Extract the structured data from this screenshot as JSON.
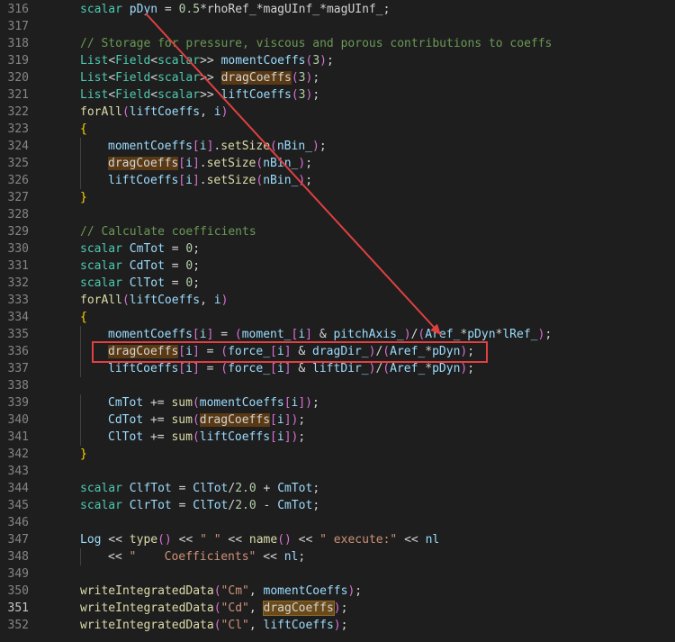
{
  "editor": {
    "active_line": "351",
    "lines": [
      {
        "n": "316",
        "indent": 1,
        "tokens": [
          [
            "ty",
            "scalar"
          ],
          [
            "op",
            " "
          ],
          [
            "va",
            "pDyn"
          ],
          [
            "op",
            " = "
          ],
          [
            "nu",
            "0.5"
          ],
          [
            "op",
            "*rhoRef_*magUInf_*magUInf_;"
          ]
        ]
      },
      {
        "n": "317",
        "indent": 0,
        "tokens": []
      },
      {
        "n": "318",
        "indent": 1,
        "tokens": [
          [
            "cm",
            "// Storage for pressure, viscous and porous contributions to coeffs"
          ]
        ]
      },
      {
        "n": "319",
        "indent": 1,
        "tokens": [
          [
            "ty",
            "List"
          ],
          [
            "op",
            "<"
          ],
          [
            "ty",
            "Field"
          ],
          [
            "op",
            "<"
          ],
          [
            "ty",
            "scalar"
          ],
          [
            "op",
            ">> "
          ],
          [
            "va",
            "momentCoeffs"
          ],
          [
            "br",
            "("
          ],
          [
            "nu",
            "3"
          ],
          [
            "br",
            ")"
          ],
          [
            "op",
            ";"
          ]
        ]
      },
      {
        "n": "320",
        "indent": 1,
        "tokens": [
          [
            "ty",
            "List"
          ],
          [
            "op",
            "<"
          ],
          [
            "ty",
            "Field"
          ],
          [
            "op",
            "<"
          ],
          [
            "ty",
            "scalar"
          ],
          [
            "op",
            ">> "
          ],
          [
            "hl",
            "dragCoeffs"
          ],
          [
            "br",
            "("
          ],
          [
            "nu",
            "3"
          ],
          [
            "br",
            ")"
          ],
          [
            "op",
            ";"
          ]
        ]
      },
      {
        "n": "321",
        "indent": 1,
        "tokens": [
          [
            "ty",
            "List"
          ],
          [
            "op",
            "<"
          ],
          [
            "ty",
            "Field"
          ],
          [
            "op",
            "<"
          ],
          [
            "ty",
            "scalar"
          ],
          [
            "op",
            ">> "
          ],
          [
            "va",
            "liftCoeffs"
          ],
          [
            "br",
            "("
          ],
          [
            "nu",
            "3"
          ],
          [
            "br",
            ")"
          ],
          [
            "op",
            ";"
          ]
        ]
      },
      {
        "n": "322",
        "indent": 1,
        "tokens": [
          [
            "kw",
            "forAll"
          ],
          [
            "br",
            "("
          ],
          [
            "va",
            "liftCoeffs"
          ],
          [
            "op",
            ", "
          ],
          [
            "va",
            "i"
          ],
          [
            "br",
            ")"
          ]
        ]
      },
      {
        "n": "323",
        "indent": 1,
        "tokens": [
          [
            "pu",
            "{"
          ]
        ]
      },
      {
        "n": "324",
        "indent": 2,
        "tokens": [
          [
            "va",
            "momentCoeffs"
          ],
          [
            "br",
            "["
          ],
          [
            "va",
            "i"
          ],
          [
            "br",
            "]"
          ],
          [
            "op",
            "."
          ],
          [
            "kw",
            "setSize"
          ],
          [
            "br",
            "("
          ],
          [
            "va",
            "nBin_"
          ],
          [
            "br",
            ")"
          ],
          [
            "op",
            ";"
          ]
        ]
      },
      {
        "n": "325",
        "indent": 2,
        "tokens": [
          [
            "hl",
            "dragCoeffs"
          ],
          [
            "br",
            "["
          ],
          [
            "va",
            "i"
          ],
          [
            "br",
            "]"
          ],
          [
            "op",
            "."
          ],
          [
            "kw",
            "setSize"
          ],
          [
            "br",
            "("
          ],
          [
            "va",
            "nBin_"
          ],
          [
            "br",
            ")"
          ],
          [
            "op",
            ";"
          ]
        ]
      },
      {
        "n": "326",
        "indent": 2,
        "tokens": [
          [
            "va",
            "liftCoeffs"
          ],
          [
            "br",
            "["
          ],
          [
            "va",
            "i"
          ],
          [
            "br",
            "]"
          ],
          [
            "op",
            "."
          ],
          [
            "kw",
            "setSize"
          ],
          [
            "br",
            "("
          ],
          [
            "va",
            "nBin_"
          ],
          [
            "br",
            ")"
          ],
          [
            "op",
            ";"
          ]
        ]
      },
      {
        "n": "327",
        "indent": 1,
        "tokens": [
          [
            "pu",
            "}"
          ]
        ]
      },
      {
        "n": "328",
        "indent": 0,
        "tokens": []
      },
      {
        "n": "329",
        "indent": 1,
        "tokens": [
          [
            "cm",
            "// Calculate coefficients"
          ]
        ]
      },
      {
        "n": "330",
        "indent": 1,
        "tokens": [
          [
            "ty",
            "scalar"
          ],
          [
            "op",
            " "
          ],
          [
            "va",
            "CmTot"
          ],
          [
            "op",
            " = "
          ],
          [
            "nu",
            "0"
          ],
          [
            "op",
            ";"
          ]
        ]
      },
      {
        "n": "331",
        "indent": 1,
        "tokens": [
          [
            "ty",
            "scalar"
          ],
          [
            "op",
            " "
          ],
          [
            "va",
            "CdTot"
          ],
          [
            "op",
            " = "
          ],
          [
            "nu",
            "0"
          ],
          [
            "op",
            ";"
          ]
        ]
      },
      {
        "n": "332",
        "indent": 1,
        "tokens": [
          [
            "ty",
            "scalar"
          ],
          [
            "op",
            " "
          ],
          [
            "va",
            "ClTot"
          ],
          [
            "op",
            " = "
          ],
          [
            "nu",
            "0"
          ],
          [
            "op",
            ";"
          ]
        ]
      },
      {
        "n": "333",
        "indent": 1,
        "tokens": [
          [
            "kw",
            "forAll"
          ],
          [
            "br",
            "("
          ],
          [
            "va",
            "liftCoeffs"
          ],
          [
            "op",
            ", "
          ],
          [
            "va",
            "i"
          ],
          [
            "br",
            ")"
          ]
        ]
      },
      {
        "n": "334",
        "indent": 1,
        "tokens": [
          [
            "pu",
            "{"
          ]
        ]
      },
      {
        "n": "335",
        "indent": 2,
        "tokens": [
          [
            "va",
            "momentCoeffs"
          ],
          [
            "br",
            "["
          ],
          [
            "va",
            "i"
          ],
          [
            "br",
            "]"
          ],
          [
            "op",
            " = "
          ],
          [
            "br",
            "("
          ],
          [
            "va",
            "moment_"
          ],
          [
            "br",
            "["
          ],
          [
            "va",
            "i"
          ],
          [
            "br",
            "]"
          ],
          [
            "op",
            " & "
          ],
          [
            "va",
            "pitchAxis_"
          ],
          [
            "br",
            ")"
          ],
          [
            "op",
            "/"
          ],
          [
            "br",
            "("
          ],
          [
            "va",
            "Aref_"
          ],
          [
            "op",
            "*"
          ],
          [
            "va",
            "pDyn"
          ],
          [
            "op",
            "*"
          ],
          [
            "va",
            "lRef_"
          ],
          [
            "br",
            ")"
          ],
          [
            "op",
            ";"
          ]
        ]
      },
      {
        "n": "336",
        "indent": 2,
        "tokens": [
          [
            "hl",
            "dragCoeffs"
          ],
          [
            "br",
            "["
          ],
          [
            "va",
            "i"
          ],
          [
            "br",
            "]"
          ],
          [
            "op",
            " = "
          ],
          [
            "br",
            "("
          ],
          [
            "va",
            "force_"
          ],
          [
            "br",
            "["
          ],
          [
            "va",
            "i"
          ],
          [
            "br",
            "]"
          ],
          [
            "op",
            " & "
          ],
          [
            "va",
            "dragDir_"
          ],
          [
            "br",
            ")"
          ],
          [
            "op",
            "/"
          ],
          [
            "br",
            "("
          ],
          [
            "va",
            "Aref_"
          ],
          [
            "op",
            "*"
          ],
          [
            "va",
            "pDyn"
          ],
          [
            "br",
            ")"
          ],
          [
            "op",
            ";"
          ]
        ]
      },
      {
        "n": "337",
        "indent": 2,
        "tokens": [
          [
            "va",
            "liftCoeffs"
          ],
          [
            "br",
            "["
          ],
          [
            "va",
            "i"
          ],
          [
            "br",
            "]"
          ],
          [
            "op",
            " = "
          ],
          [
            "br",
            "("
          ],
          [
            "va",
            "force_"
          ],
          [
            "br",
            "["
          ],
          [
            "va",
            "i"
          ],
          [
            "br",
            "]"
          ],
          [
            "op",
            " & "
          ],
          [
            "va",
            "liftDir_"
          ],
          [
            "br",
            ")"
          ],
          [
            "op",
            "/"
          ],
          [
            "br",
            "("
          ],
          [
            "va",
            "Aref_"
          ],
          [
            "op",
            "*"
          ],
          [
            "va",
            "pDyn"
          ],
          [
            "br",
            ")"
          ],
          [
            "op",
            ";"
          ]
        ]
      },
      {
        "n": "338",
        "indent": 0,
        "tokens": []
      },
      {
        "n": "339",
        "indent": 2,
        "tokens": [
          [
            "va",
            "CmTot"
          ],
          [
            "op",
            " += "
          ],
          [
            "kw",
            "sum"
          ],
          [
            "br",
            "("
          ],
          [
            "va",
            "momentCoeffs"
          ],
          [
            "br",
            "["
          ],
          [
            "va",
            "i"
          ],
          [
            "br",
            "]"
          ],
          [
            "br",
            ")"
          ],
          [
            "op",
            ";"
          ]
        ]
      },
      {
        "n": "340",
        "indent": 2,
        "tokens": [
          [
            "va",
            "CdTot"
          ],
          [
            "op",
            " += "
          ],
          [
            "kw",
            "sum"
          ],
          [
            "br",
            "("
          ],
          [
            "hl",
            "dragCoeffs"
          ],
          [
            "br",
            "["
          ],
          [
            "va",
            "i"
          ],
          [
            "br",
            "]"
          ],
          [
            "br",
            ")"
          ],
          [
            "op",
            ";"
          ]
        ]
      },
      {
        "n": "341",
        "indent": 2,
        "tokens": [
          [
            "va",
            "ClTot"
          ],
          [
            "op",
            " += "
          ],
          [
            "kw",
            "sum"
          ],
          [
            "br",
            "("
          ],
          [
            "va",
            "liftCoeffs"
          ],
          [
            "br",
            "["
          ],
          [
            "va",
            "i"
          ],
          [
            "br",
            "]"
          ],
          [
            "br",
            ")"
          ],
          [
            "op",
            ";"
          ]
        ]
      },
      {
        "n": "342",
        "indent": 1,
        "tokens": [
          [
            "pu",
            "}"
          ]
        ]
      },
      {
        "n": "343",
        "indent": 0,
        "tokens": []
      },
      {
        "n": "344",
        "indent": 1,
        "tokens": [
          [
            "ty",
            "scalar"
          ],
          [
            "op",
            " "
          ],
          [
            "va",
            "ClfTot"
          ],
          [
            "op",
            " = "
          ],
          [
            "va",
            "ClTot"
          ],
          [
            "op",
            "/"
          ],
          [
            "nu",
            "2.0"
          ],
          [
            "op",
            " + "
          ],
          [
            "va",
            "CmTot"
          ],
          [
            "op",
            ";"
          ]
        ]
      },
      {
        "n": "345",
        "indent": 1,
        "tokens": [
          [
            "ty",
            "scalar"
          ],
          [
            "op",
            " "
          ],
          [
            "va",
            "ClrTot"
          ],
          [
            "op",
            " = "
          ],
          [
            "va",
            "ClTot"
          ],
          [
            "op",
            "/"
          ],
          [
            "nu",
            "2.0"
          ],
          [
            "op",
            " - "
          ],
          [
            "va",
            "CmTot"
          ],
          [
            "op",
            ";"
          ]
        ]
      },
      {
        "n": "346",
        "indent": 0,
        "tokens": []
      },
      {
        "n": "347",
        "indent": 1,
        "tokens": [
          [
            "va",
            "Log"
          ],
          [
            "op",
            " << "
          ],
          [
            "kw",
            "type"
          ],
          [
            "br",
            "()"
          ],
          [
            "op",
            " << "
          ],
          [
            "st",
            "\" \""
          ],
          [
            "op",
            " << "
          ],
          [
            "kw",
            "name"
          ],
          [
            "br",
            "()"
          ],
          [
            "op",
            " << "
          ],
          [
            "st",
            "\" execute:\""
          ],
          [
            "op",
            " << "
          ],
          [
            "va",
            "nl"
          ]
        ]
      },
      {
        "n": "348",
        "indent": 2,
        "tokens": [
          [
            "op",
            "<< "
          ],
          [
            "st",
            "\"    Coefficients\""
          ],
          [
            "op",
            " << "
          ],
          [
            "va",
            "nl"
          ],
          [
            "op",
            ";"
          ]
        ]
      },
      {
        "n": "349",
        "indent": 0,
        "tokens": []
      },
      {
        "n": "350",
        "indent": 1,
        "tokens": [
          [
            "kw",
            "writeIntegratedData"
          ],
          [
            "br",
            "("
          ],
          [
            "st",
            "\"Cm\""
          ],
          [
            "op",
            ", "
          ],
          [
            "va",
            "momentCoeffs"
          ],
          [
            "br",
            ")"
          ],
          [
            "op",
            ";"
          ]
        ]
      },
      {
        "n": "351",
        "indent": 1,
        "tokens": [
          [
            "kw",
            "writeIntegratedData"
          ],
          [
            "br",
            "("
          ],
          [
            "st",
            "\"Cd\""
          ],
          [
            "op",
            ", "
          ],
          [
            "hlc",
            "dragCoeffs"
          ],
          [
            "br",
            ")"
          ],
          [
            "op",
            ";"
          ]
        ]
      },
      {
        "n": "352",
        "indent": 1,
        "tokens": [
          [
            "kw",
            "writeIntegratedData"
          ],
          [
            "br",
            "("
          ],
          [
            "st",
            "\"Cl\""
          ],
          [
            "op",
            ", "
          ],
          [
            "va",
            "liftCoeffs"
          ],
          [
            "br",
            ")"
          ],
          [
            "op",
            ";"
          ]
        ]
      }
    ]
  },
  "annotation": {
    "color": "#e04040",
    "box_line": "336",
    "arrow_from_line": "316",
    "arrow_to_line": "335"
  }
}
